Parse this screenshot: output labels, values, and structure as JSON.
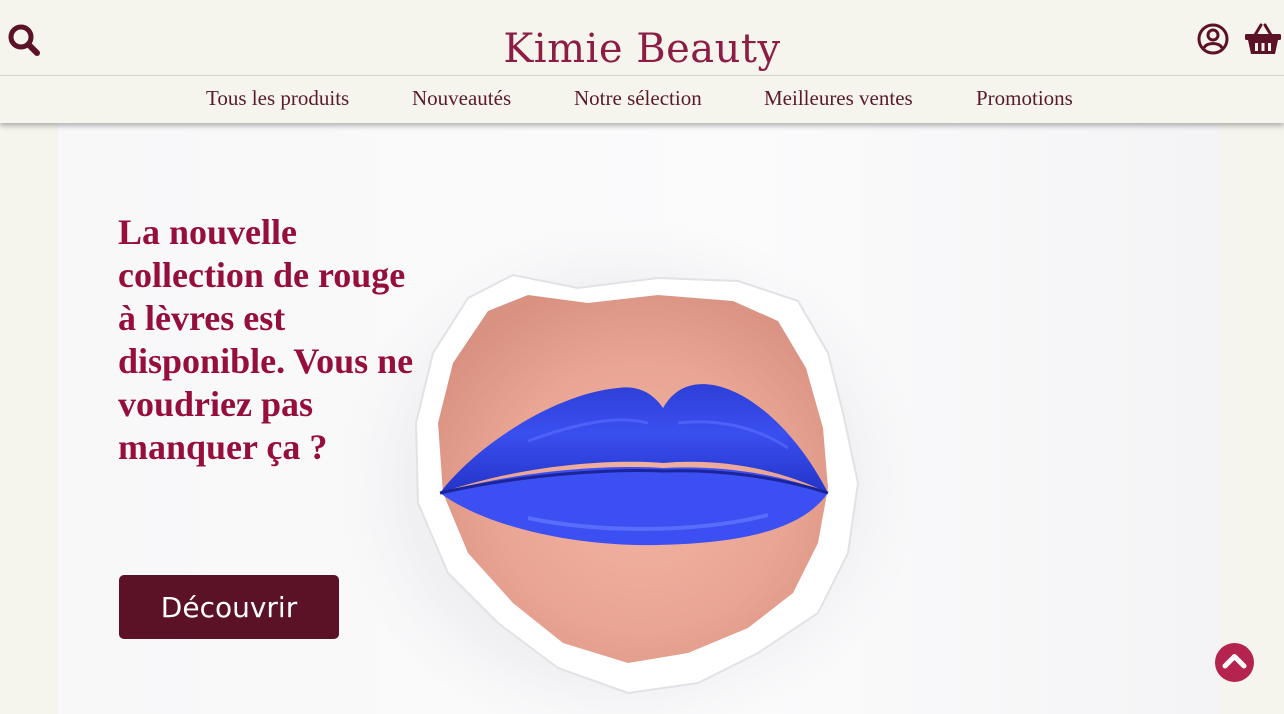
{
  "brand": {
    "name": "Kimie Beauty",
    "color": "#8c1d45"
  },
  "header": {
    "icons": {
      "search": "search-icon",
      "account": "user-circle-icon",
      "cart": "shopping-basket-icon"
    }
  },
  "nav": {
    "items": [
      {
        "label": "Tous les produits"
      },
      {
        "label": "Nouveautés"
      },
      {
        "label": "Notre sélection"
      },
      {
        "label": "Meilleures ventes"
      },
      {
        "label": "Promotions"
      }
    ]
  },
  "hero": {
    "headline": "La nouvelle collection de rouge à lèvres est disponible. Vous ne voudriez pas manquer ça ?",
    "cta_label": "Découvrir",
    "image": "blue-lips-through-torn-paper"
  },
  "back_to_top": {
    "icon": "chevron-up-icon"
  },
  "colors": {
    "background": "#f5f5ed",
    "headline": "#960f3c",
    "button": "#5c1226",
    "nav_text": "#5a1a2a",
    "icon": "#5c1226",
    "back_to_top": "#b5234f"
  }
}
